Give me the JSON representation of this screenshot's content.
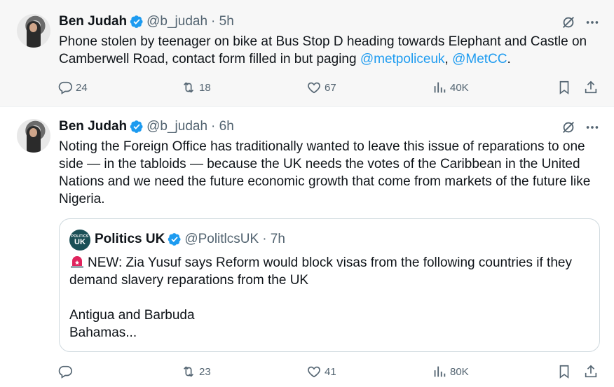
{
  "tweets": [
    {
      "name": "Ben Judah",
      "handle": "@b_judah",
      "time": "· 5h",
      "text_before": "Phone stolen by teenager on bike at Bus Stop D heading towards Elephant and Castle on Camberwell Road, contact form filled in but paging ",
      "mention_1": "@metpoliceuk",
      "separator": ", ",
      "mention_2": "@MetCC",
      "text_after": ".",
      "replies": "24",
      "retweets": "18",
      "likes": "67",
      "views": "40K"
    },
    {
      "name": "Ben Judah",
      "handle": "@b_judah",
      "time": "· 6h",
      "text": "Noting the Foreign Office has traditionally wanted to leave this issue of reparations to one side — in the tabloids — because the UK needs the votes of the Caribbean in the United Nations and we need the future economic growth that come from markets of the future like Nigeria.",
      "replies": "",
      "retweets": "23",
      "likes": "41",
      "views": "80K",
      "quote": {
        "name": "Politics UK",
        "handle": "@PolitlcsUK",
        "time": "· 7h",
        "avatar_small": "POLITICS",
        "avatar_big": "UK",
        "line_1": "NEW: Zia Yusuf says Reform would block visas from the following countries if they demand slavery reparations from the UK",
        "line_2": "Antigua and Barbuda",
        "line_3": "Bahamas..."
      }
    }
  ],
  "colors": {
    "accent": "#1d9bf0",
    "muted": "#536471",
    "text": "#0f1419",
    "first_bg": "#f7f7f7"
  },
  "icons": [
    "verified-badge-icon",
    "grok-icon",
    "more-icon",
    "reply-icon",
    "retweet-icon",
    "like-icon",
    "views-icon",
    "bookmark-icon",
    "share-icon",
    "siren-icon"
  ]
}
